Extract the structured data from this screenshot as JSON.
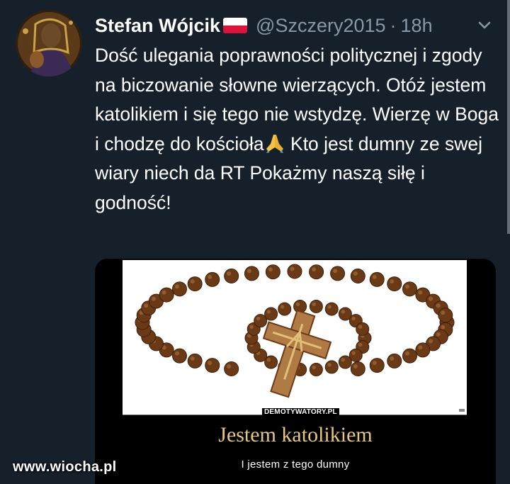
{
  "tweet": {
    "display_name": "Stefan Wójcik",
    "handle": "@Szczery2015",
    "separator": "·",
    "time": "18h",
    "text_before_emoji": "Dość ulegania poprawności politycznej i zgody na biczowanie słowne wierzących. Otóż jestem katolikiem i się tego nie wstydzę. Wierzę w Boga i chodzę do kościoła",
    "text_after_emoji": " Kto jest dumny ze swej wiary niech da RT Pokażmy naszą siłę i godność!",
    "emoji": "folded-hands-emoji",
    "flag": "poland-flag"
  },
  "media": {
    "watermark": "DEMOTYWATORY.PL",
    "title": "Jestem katolikiem",
    "subtitle": "I jestem z tego dumny"
  },
  "site_watermark": "www.wiocha.pl",
  "colors": {
    "background": "#15202b",
    "muted": "#8899a6",
    "poster_title": "#e6c77b",
    "flag_red": "#dc143c"
  }
}
